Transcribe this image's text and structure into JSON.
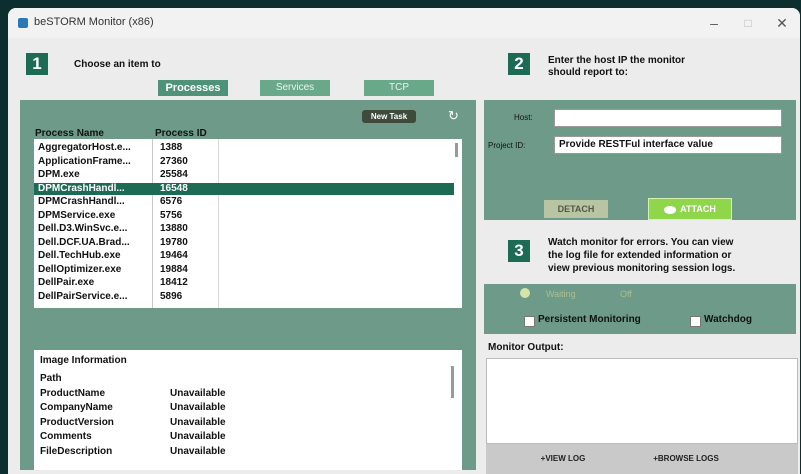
{
  "window": {
    "title": "beSTORM Monitor (x86)",
    "min_icon": "minimize-icon",
    "max_icon": "maximize-icon",
    "close_icon": "close-icon"
  },
  "step1": {
    "number": "1",
    "label": "Choose an item to"
  },
  "tabs": [
    {
      "label": "Processes"
    },
    {
      "label": "Services"
    },
    {
      "label": "TCP"
    }
  ],
  "processes": {
    "new_task": "New Task",
    "refresh_icon": "refresh-icon",
    "col_name": "Process Name",
    "col_id": "Process ID",
    "rows": [
      {
        "name": "AggregatorHost.e...",
        "id": "1388"
      },
      {
        "name": "ApplicationFrame...",
        "id": "27360"
      },
      {
        "name": "DPM.exe",
        "id": "25584"
      },
      {
        "name": "DPMCrashHandl...",
        "id": "16548"
      },
      {
        "name": "DPMCrashHandl...",
        "id": "6576"
      },
      {
        "name": "DPMService.exe",
        "id": "5756"
      },
      {
        "name": "Dell.D3.WinSvc.e...",
        "id": "13880"
      },
      {
        "name": "Dell.DCF.UA.Brad...",
        "id": "19780"
      },
      {
        "name": "Dell.TechHub.exe",
        "id": "19464"
      },
      {
        "name": "DellOptimizer.exe",
        "id": "19884"
      },
      {
        "name": "DellPair.exe",
        "id": "18412"
      },
      {
        "name": "DellPairService.e...",
        "id": "5896"
      }
    ],
    "selected_index": 3
  },
  "image_info": {
    "title": "Image Information",
    "rows": [
      {
        "key": "Path",
        "value": ""
      },
      {
        "key": "ProductName",
        "value": "Unavailable"
      },
      {
        "key": "CompanyName",
        "value": "Unavailable"
      },
      {
        "key": "ProductVersion",
        "value": "Unavailable"
      },
      {
        "key": "Comments",
        "value": "Unavailable"
      },
      {
        "key": "FileDescription",
        "value": "Unavailable"
      }
    ]
  },
  "step2": {
    "number": "2",
    "label_line1": "Enter the host IP the monitor",
    "label_line2": "should report to:",
    "host_label": "Host:",
    "host_value": "",
    "project_label": "Project ID:",
    "project_value": "Provide RESTFul interface value",
    "detach": "DETACH",
    "attach": "ATTACH",
    "attach_icon": "eye-icon"
  },
  "step3": {
    "number": "3",
    "line1": "Watch monitor for errors. You can view",
    "line2": "the log file for extended information or",
    "line3": "view previous monitoring session logs.",
    "status_label": "Waiting",
    "status_value": "Off",
    "persistent": "Persistent Monitoring",
    "watchdog": "Watchdog"
  },
  "output": {
    "label": "Monitor Output:",
    "view_log": "+VIEW LOG",
    "browse_logs": "+BROWSE LOGS"
  }
}
